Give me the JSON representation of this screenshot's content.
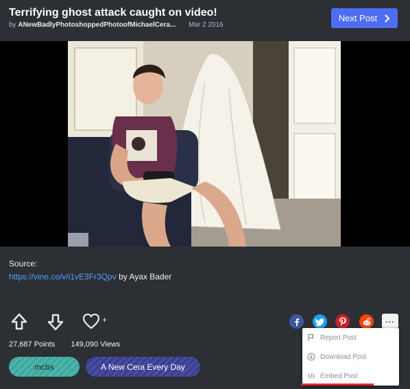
{
  "post": {
    "title": "Terrifying ghost attack caught on video!",
    "by_prefix": "by",
    "author": "ANewBadlyPhotoshoppedPhotoofMichaelCera...",
    "date": "Mar 2 2016"
  },
  "header": {
    "next_label": "Next Post"
  },
  "source": {
    "label": "Source:",
    "url": "https://vine.co/v/i1vE3Fr3Qpv",
    "credit": "by Ayax Bader"
  },
  "actions": {
    "fav_plus": "+"
  },
  "stats": {
    "points": "27,687 Points",
    "views": "149,090 Views"
  },
  "tags": [
    "mcbs",
    "A New Cera Every Day"
  ],
  "share": {
    "fb": "f",
    "tw": "t",
    "pin": "p",
    "rd": "r"
  },
  "menu": {
    "more": "...",
    "items": [
      "Report Post",
      "Download Post",
      "Embed Post"
    ]
  },
  "colors": {
    "background": "#2c2f34",
    "accent": "#4e6ef2",
    "link": "#56a0ff",
    "embed_underline": "#e3242b"
  }
}
